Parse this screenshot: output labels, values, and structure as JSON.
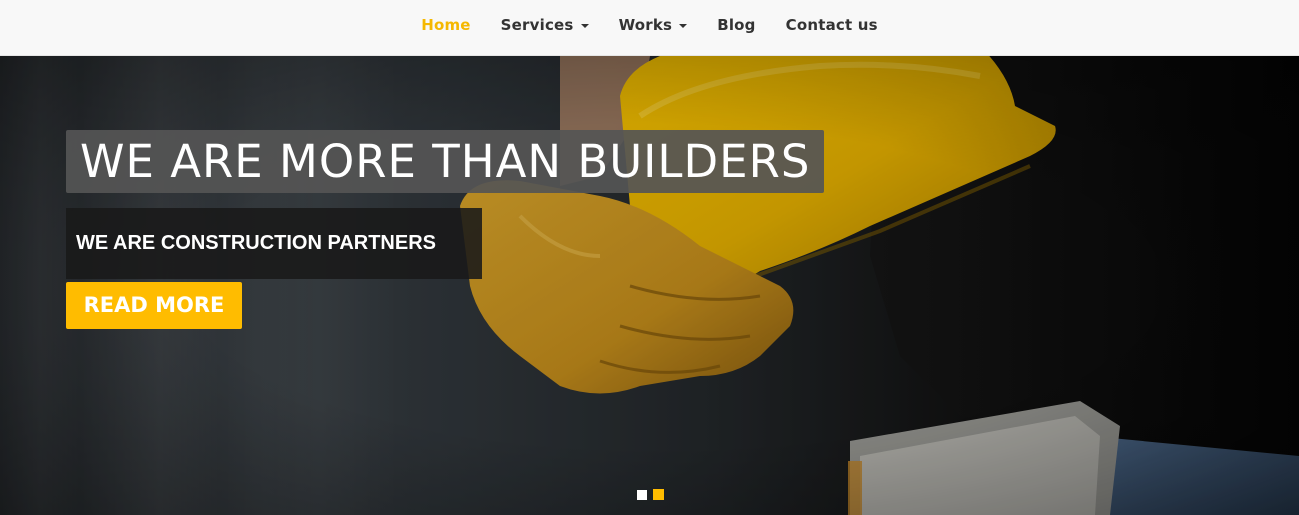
{
  "nav": {
    "items": [
      {
        "label": "Home",
        "active": true,
        "dropdown": false
      },
      {
        "label": "Services",
        "active": false,
        "dropdown": true
      },
      {
        "label": "Works",
        "active": false,
        "dropdown": true
      },
      {
        "label": "Blog",
        "active": false,
        "dropdown": false
      },
      {
        "label": "Contact us",
        "active": false,
        "dropdown": false
      }
    ]
  },
  "hero": {
    "headline": "WE ARE MORE THAN BUILDERS",
    "subheadline": "WE ARE CONSTRUCTION PARTNERS",
    "cta_label": "READ MORE",
    "background_image": "worker-holding-yellow-hard-hat-and-gloves",
    "slides_total": 2,
    "active_slide": 2
  },
  "colors": {
    "accent": "#ffbc00",
    "nav_active": "#f5b800",
    "nav_text": "#333333",
    "nav_bg": "#f8f8f8"
  }
}
